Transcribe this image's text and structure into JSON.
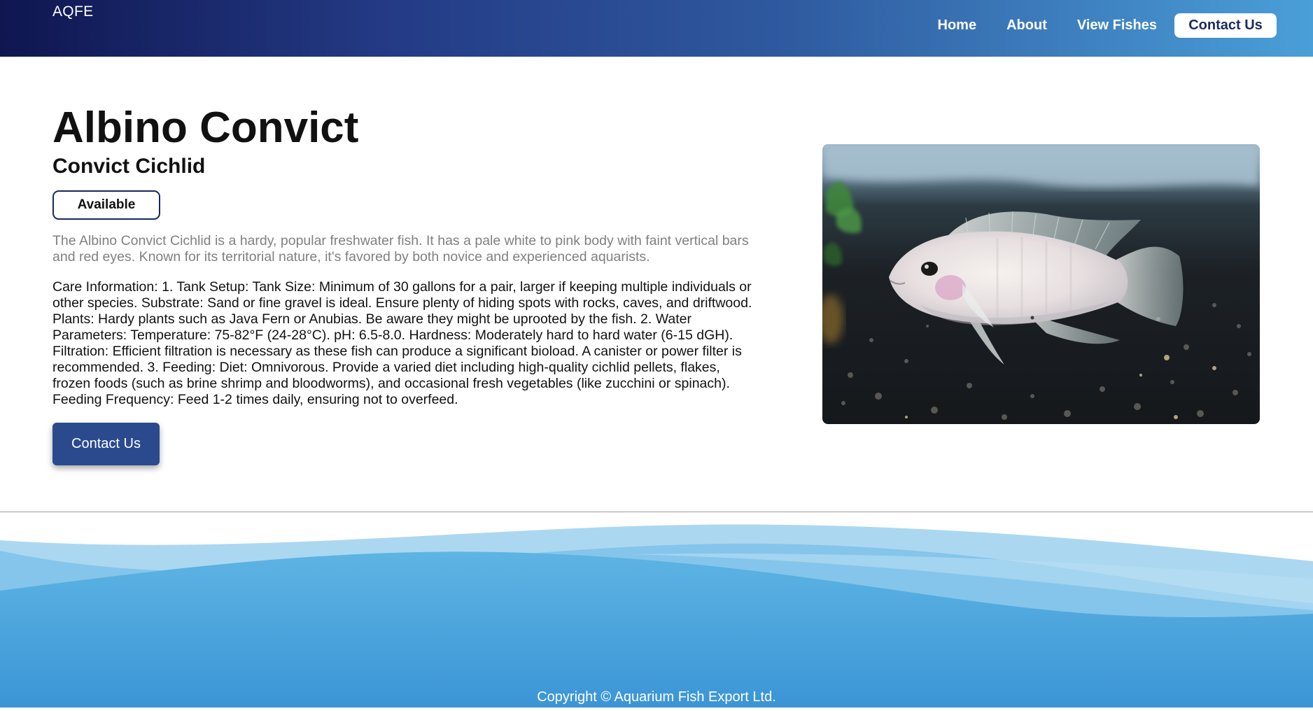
{
  "header": {
    "brand": "AQFE",
    "nav": {
      "home": "Home",
      "about": "About",
      "view_fishes": "View Fishes",
      "contact": "Contact Us"
    }
  },
  "fish": {
    "name": "Albino Convict",
    "common_name": "Convict Cichlid",
    "status": "Available",
    "description": "The Albino Convict Cichlid is a hardy, popular freshwater fish. It has a pale white to pink body with faint vertical bars and red eyes. Known for its territorial nature, it's favored by both novice and experienced aquarists.",
    "care_info": "Care Information: 1. Tank Setup: Tank Size: Minimum of 30 gallons for a pair, larger if keeping multiple individuals or other species. Substrate: Sand or fine gravel is ideal. Ensure plenty of hiding spots with rocks, caves, and driftwood. Plants: Hardy plants such as Java Fern or Anubias. Be aware they might be uprooted by the fish. 2. Water Parameters: Temperature: 75-82°F (24-28°C). pH: 6.5-8.0. Hardness: Moderately hard to hard water (6-15 dGH). Filtration: Efficient filtration is necessary as these fish can produce a significant bioload. A canister or power filter is recommended. 3. Feeding: Diet: Omnivorous. Provide a varied diet including high-quality cichlid pellets, flakes, frozen foods (such as brine shrimp and bloodworms), and occasional fresh vegetables (like zucchini or spinach). Feeding Frequency: Feed 1-2 times daily, ensuring not to overfeed.",
    "contact_button": "Contact Us"
  },
  "footer": {
    "copyright": "Copyright © Aquarium Fish Export Ltd."
  },
  "colors": {
    "header_start": "#0f1650",
    "header_end": "#4a9fd8",
    "button_bg": "#2b4a8e",
    "wave_main": "#5aafe0"
  }
}
